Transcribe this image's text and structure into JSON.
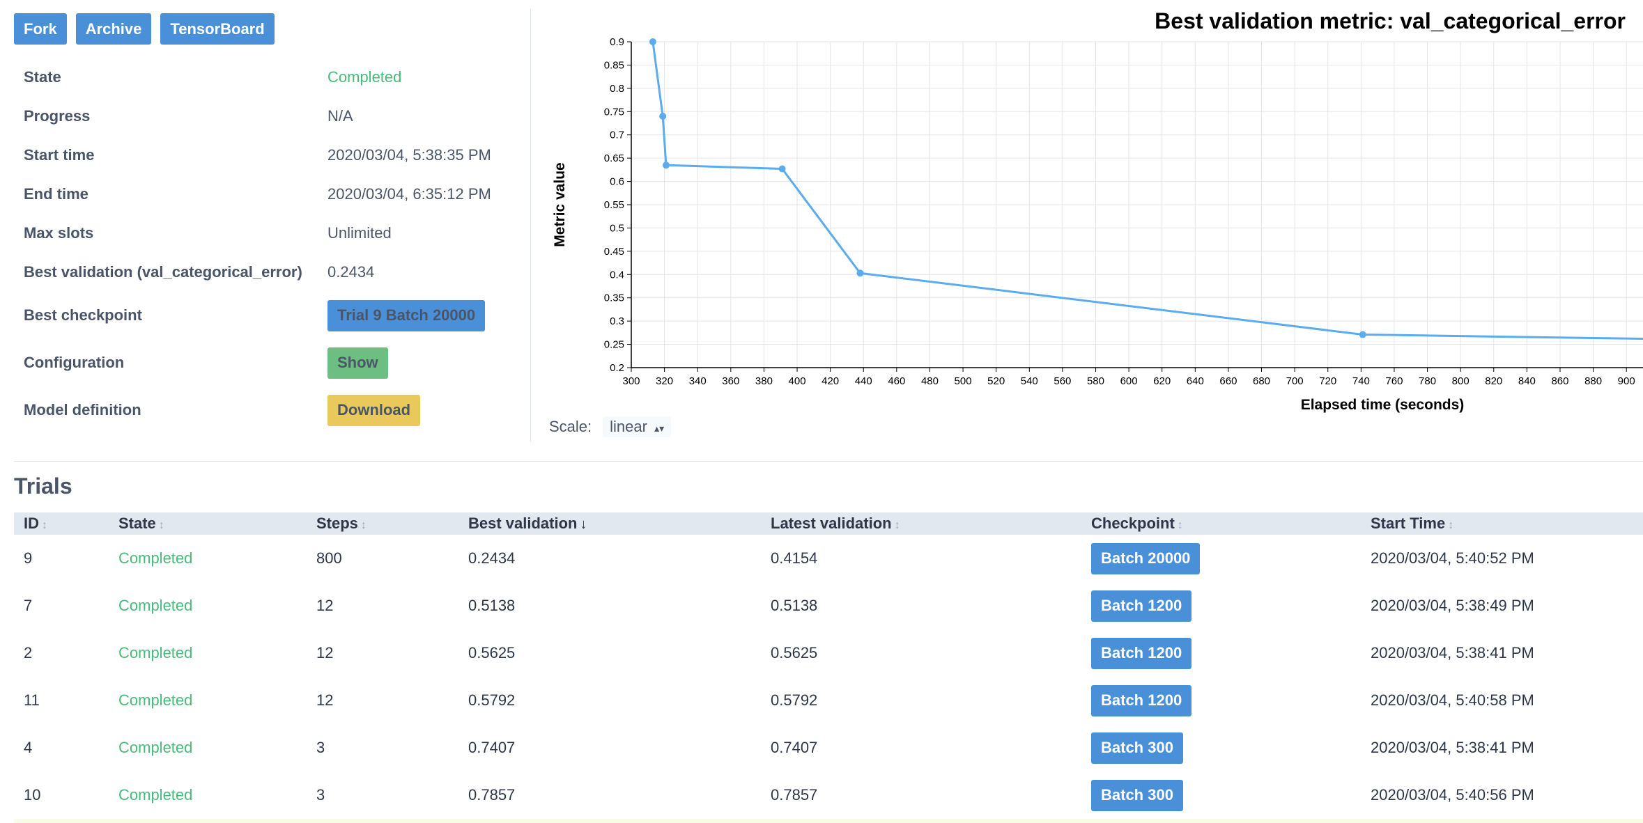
{
  "toolbar": {
    "fork": "Fork",
    "archive": "Archive",
    "tensorboard": "TensorBoard"
  },
  "info": [
    {
      "label": "State",
      "value": "Completed",
      "kind": "status"
    },
    {
      "label": "Progress",
      "value": "N/A",
      "kind": "text"
    },
    {
      "label": "Start time",
      "value": "2020/03/04, 5:38:35 PM",
      "kind": "text"
    },
    {
      "label": "End time",
      "value": "2020/03/04, 6:35:12 PM",
      "kind": "text"
    },
    {
      "label": "Max slots",
      "value": "Unlimited",
      "kind": "text"
    },
    {
      "label": "Best validation (val_categorical_error)",
      "value": "0.2434",
      "kind": "text"
    },
    {
      "label": "Best checkpoint",
      "value": "Trial 9 Batch 20000",
      "kind": "button-blue"
    },
    {
      "label": "Configuration",
      "value": "Show",
      "kind": "button-green"
    },
    {
      "label": "Model definition",
      "value": "Download",
      "kind": "button-yellow"
    }
  ],
  "chart_data": {
    "type": "line",
    "title": "Best validation metric: val_categorical_error",
    "xlabel": "Elapsed time (seconds)",
    "ylabel": "Metric value",
    "x": [
      313,
      319,
      321,
      391,
      438,
      741,
      910
    ],
    "y": [
      0.9,
      0.74,
      0.635,
      0.627,
      0.403,
      0.271,
      0.262
    ],
    "xlim": [
      300,
      910
    ],
    "ylim": [
      0.2,
      0.9
    ],
    "xticks": [
      300,
      320,
      340,
      360,
      380,
      400,
      420,
      440,
      460,
      480,
      500,
      520,
      540,
      560,
      580,
      600,
      620,
      640,
      660,
      680,
      700,
      720,
      740,
      760,
      780,
      800,
      820,
      840,
      860,
      880,
      900
    ],
    "yticks": [
      0.2,
      0.25,
      0.3,
      0.35,
      0.4,
      0.45,
      0.5,
      0.55,
      0.6,
      0.65,
      0.7,
      0.75,
      0.8,
      0.85,
      0.9
    ],
    "grid": true,
    "color": "#5aacef"
  },
  "scale": {
    "label": "Scale:",
    "value": "linear"
  },
  "trials": {
    "title": "Trials",
    "columns": [
      "ID",
      "State",
      "Steps",
      "Best validation",
      "Latest validation",
      "Checkpoint",
      "Start Time"
    ],
    "rows": [
      {
        "id": "9",
        "state": "Completed",
        "steps": "800",
        "best": "0.2434",
        "latest": "0.4154",
        "checkpoint": "Batch 20000",
        "start": "2020/03/04, 5:40:52 PM"
      },
      {
        "id": "7",
        "state": "Completed",
        "steps": "12",
        "best": "0.5138",
        "latest": "0.5138",
        "checkpoint": "Batch 1200",
        "start": "2020/03/04, 5:38:49 PM"
      },
      {
        "id": "2",
        "state": "Completed",
        "steps": "12",
        "best": "0.5625",
        "latest": "0.5625",
        "checkpoint": "Batch 1200",
        "start": "2020/03/04, 5:38:41 PM"
      },
      {
        "id": "11",
        "state": "Completed",
        "steps": "12",
        "best": "0.5792",
        "latest": "0.5792",
        "checkpoint": "Batch 1200",
        "start": "2020/03/04, 5:40:58 PM"
      },
      {
        "id": "4",
        "state": "Completed",
        "steps": "3",
        "best": "0.7407",
        "latest": "0.7407",
        "checkpoint": "Batch 300",
        "start": "2020/03/04, 5:38:41 PM"
      },
      {
        "id": "10",
        "state": "Completed",
        "steps": "3",
        "best": "0.7857",
        "latest": "0.7857",
        "checkpoint": "Batch 300",
        "start": "2020/03/04, 5:40:56 PM"
      }
    ]
  }
}
